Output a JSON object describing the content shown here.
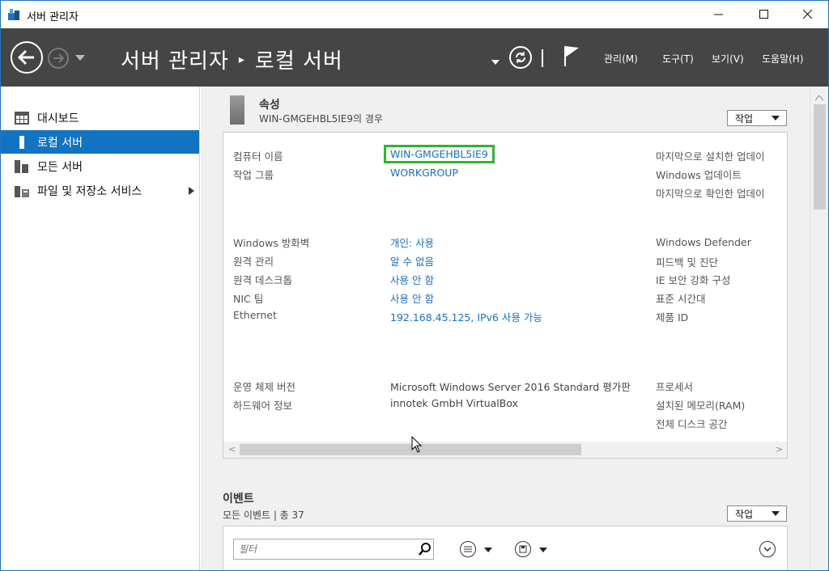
{
  "window": {
    "title": "서버 관리자"
  },
  "header": {
    "breadcrumb_root": "서버 관리자",
    "breadcrumb_sep": "▸",
    "breadcrumb_current": "로컬 서버",
    "menus": [
      "관리(M)",
      "도구(T)",
      "보기(V)",
      "도움말(H)"
    ]
  },
  "sidebar": {
    "items": [
      {
        "label": "대시보드",
        "icon": "dashboard-icon"
      },
      {
        "label": "로컬 서버",
        "icon": "local-server-icon",
        "active": true
      },
      {
        "label": "모든 서버",
        "icon": "all-servers-icon"
      },
      {
        "label": "파일 및 저장소 서비스",
        "icon": "file-storage-icon",
        "has_submenu": true
      }
    ]
  },
  "properties": {
    "title": "속성",
    "subtitle": "WIN-GMGEHBL5IE9의 경우",
    "task_label": "작업",
    "left": [
      {
        "label": "컴퓨터 이름",
        "value": "WIN-GMGEHBL5IE9"
      },
      {
        "label": "작업 그룹",
        "value": "WORKGROUP"
      },
      {
        "label": "Windows 방화벽",
        "value": "개인: 사용"
      },
      {
        "label": "원격 관리",
        "value": "알 수 없음"
      },
      {
        "label": "원격 데스크톱",
        "value": "사용 안 함"
      },
      {
        "label": "NIC 팀",
        "value": "사용 안 함"
      },
      {
        "label": "Ethernet",
        "value": "192.168.45.125, IPv6 사용 가능"
      },
      {
        "label": "운영 체제 버전",
        "value": "Microsoft Windows Server 2016 Standard 평가판"
      },
      {
        "label": "하드웨어 정보",
        "value": "innotek GmbH VirtualBox"
      }
    ],
    "right": [
      "마지막으로 설치한 업데이",
      "Windows 업데이트",
      "마지막으로 확인한 업데이",
      "Windows Defender",
      "피드백 및 진단",
      "IE 보안 강화 구성",
      "표준 시간대",
      "제품 ID",
      "프로세서",
      "설치된 메모리(RAM)",
      "전체 디스크 공간"
    ]
  },
  "events": {
    "title": "이벤트",
    "subtitle": "모든 이벤트 | 총 37",
    "task_label": "작업",
    "filter_placeholder": "필터"
  },
  "colors": {
    "header_bg": "#454545",
    "active_item": "#1273c2",
    "link": "#1c6fc2",
    "highlight": "#2db62d"
  }
}
